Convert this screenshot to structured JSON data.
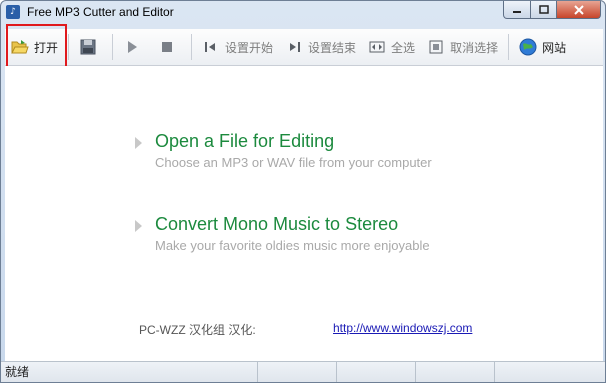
{
  "window": {
    "title": "Free MP3 Cutter and Editor",
    "icon": "app-icon"
  },
  "toolbar": {
    "open_label": "打开",
    "set_start_label": "设置开始",
    "set_end_label": "设置结束",
    "select_all_label": "全选",
    "deselect_label": "取消选择",
    "website_label": "网站"
  },
  "tasks": [
    {
      "title": "Open a File for Editing",
      "subtitle": "Choose an MP3 or WAV file from your computer"
    },
    {
      "title": "Convert Mono Music to Stereo",
      "subtitle": "Make your favorite oldies music more enjoyable"
    }
  ],
  "credits": {
    "text": "PC-WZZ 汉化组 汉化:",
    "link": "http://www.windowszj.com"
  },
  "status": {
    "text": "就绪"
  },
  "colors": {
    "task_title": "#1c8a3e",
    "highlight": "#e0191d",
    "link": "#1a1ab5"
  }
}
